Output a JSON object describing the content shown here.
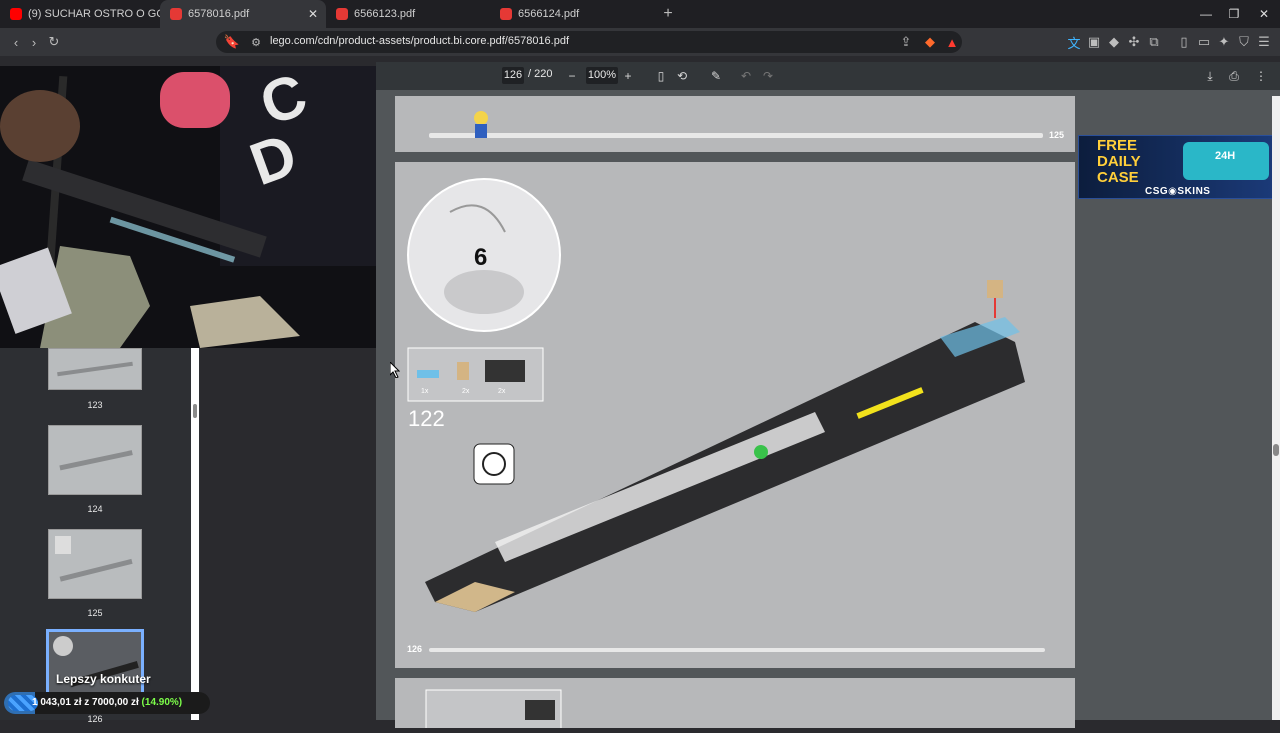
{
  "tabs": [
    {
      "label": "(9) SUCHAR OSTRO O GOODIESI OD",
      "icon": "youtube-icon",
      "color": "#ff0000"
    },
    {
      "label": "6578016.pdf",
      "icon": "pdf-icon",
      "color": "#e53935"
    },
    {
      "label": "6566123.pdf",
      "icon": "pdf-icon",
      "color": "#e53935"
    },
    {
      "label": "6566124.pdf",
      "icon": "pdf-icon",
      "color": "#e53935"
    }
  ],
  "address": {
    "url": "lego.com/cdn/product-assets/product.bi.core.pdf/6578016.pdf"
  },
  "shield_badge": "1",
  "pdf_toolbar": {
    "page": "126",
    "total": "/ 220",
    "zoom": "100%",
    "minus": "−",
    "plus": "+"
  },
  "thumbnails": [
    {
      "label": "123"
    },
    {
      "label": "124"
    },
    {
      "label": "125"
    },
    {
      "label": "126"
    }
  ],
  "overlay": {
    "name": "Lepszy konkuter",
    "current": "1 043,01 zł",
    "sep": "z",
    "goal": "7000,00 zł",
    "percent": "(14.90%)",
    "progress": 0.149
  },
  "page_top": {
    "page_number": "125"
  },
  "page_main": {
    "bag_number": "6",
    "step_number": "122",
    "page_number": "126",
    "parts": [
      "1x",
      "2x",
      "2x"
    ]
  },
  "ad": {
    "line1": "FREE",
    "line2": "DAILY",
    "line3": "CASE",
    "brand": "CSG◉SKINS",
    "tag": "24H"
  }
}
